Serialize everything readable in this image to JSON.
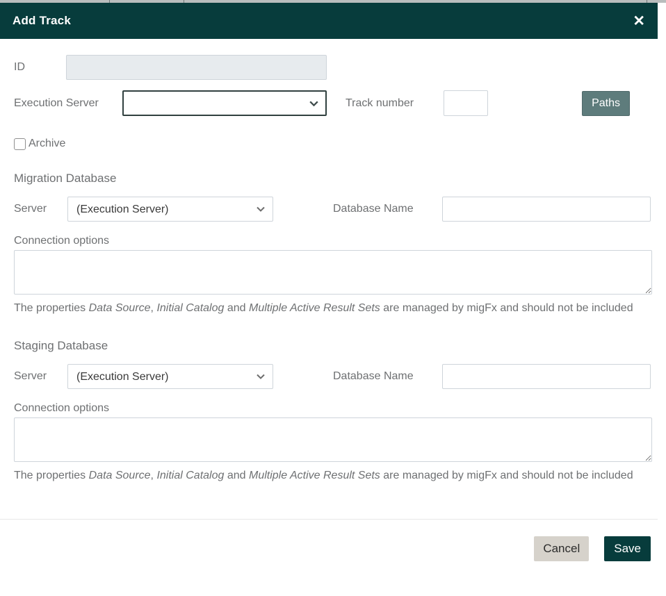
{
  "colors": {
    "accent": "#073c3c",
    "paths_button": "#5e7c7c",
    "cancel_button": "#d6d2cb",
    "disabled_input_bg": "#e7ebee"
  },
  "modal": {
    "title": "Add Track",
    "close_icon": "✕",
    "fields": {
      "id_label": "ID",
      "id_value": "",
      "execution_server_label": "Execution Server",
      "execution_server_value": "",
      "track_number_label": "Track number",
      "track_number_value": "",
      "paths_button": "Paths",
      "archive_label": "Archive"
    },
    "migration_database": {
      "heading": "Migration Database",
      "server_label": "Server",
      "server_value": "(Execution Server)",
      "database_name_label": "Database Name",
      "database_name_value": "",
      "connection_options_label": "Connection options",
      "connection_options_value": ""
    },
    "staging_database": {
      "heading": "Staging Database",
      "server_label": "Server",
      "server_value": "(Execution Server)",
      "database_name_label": "Database Name",
      "database_name_value": "",
      "connection_options_label": "Connection options",
      "connection_options_value": ""
    },
    "note": {
      "prefix": "The properties ",
      "em1": "Data Source",
      "sep1": ", ",
      "em2": "Initial Catalog",
      "sep2": " and ",
      "em3": "Multiple Active Result Sets",
      "suffix": " are managed by migFx and should not be included"
    },
    "footer": {
      "cancel": "Cancel",
      "save": "Save"
    }
  }
}
